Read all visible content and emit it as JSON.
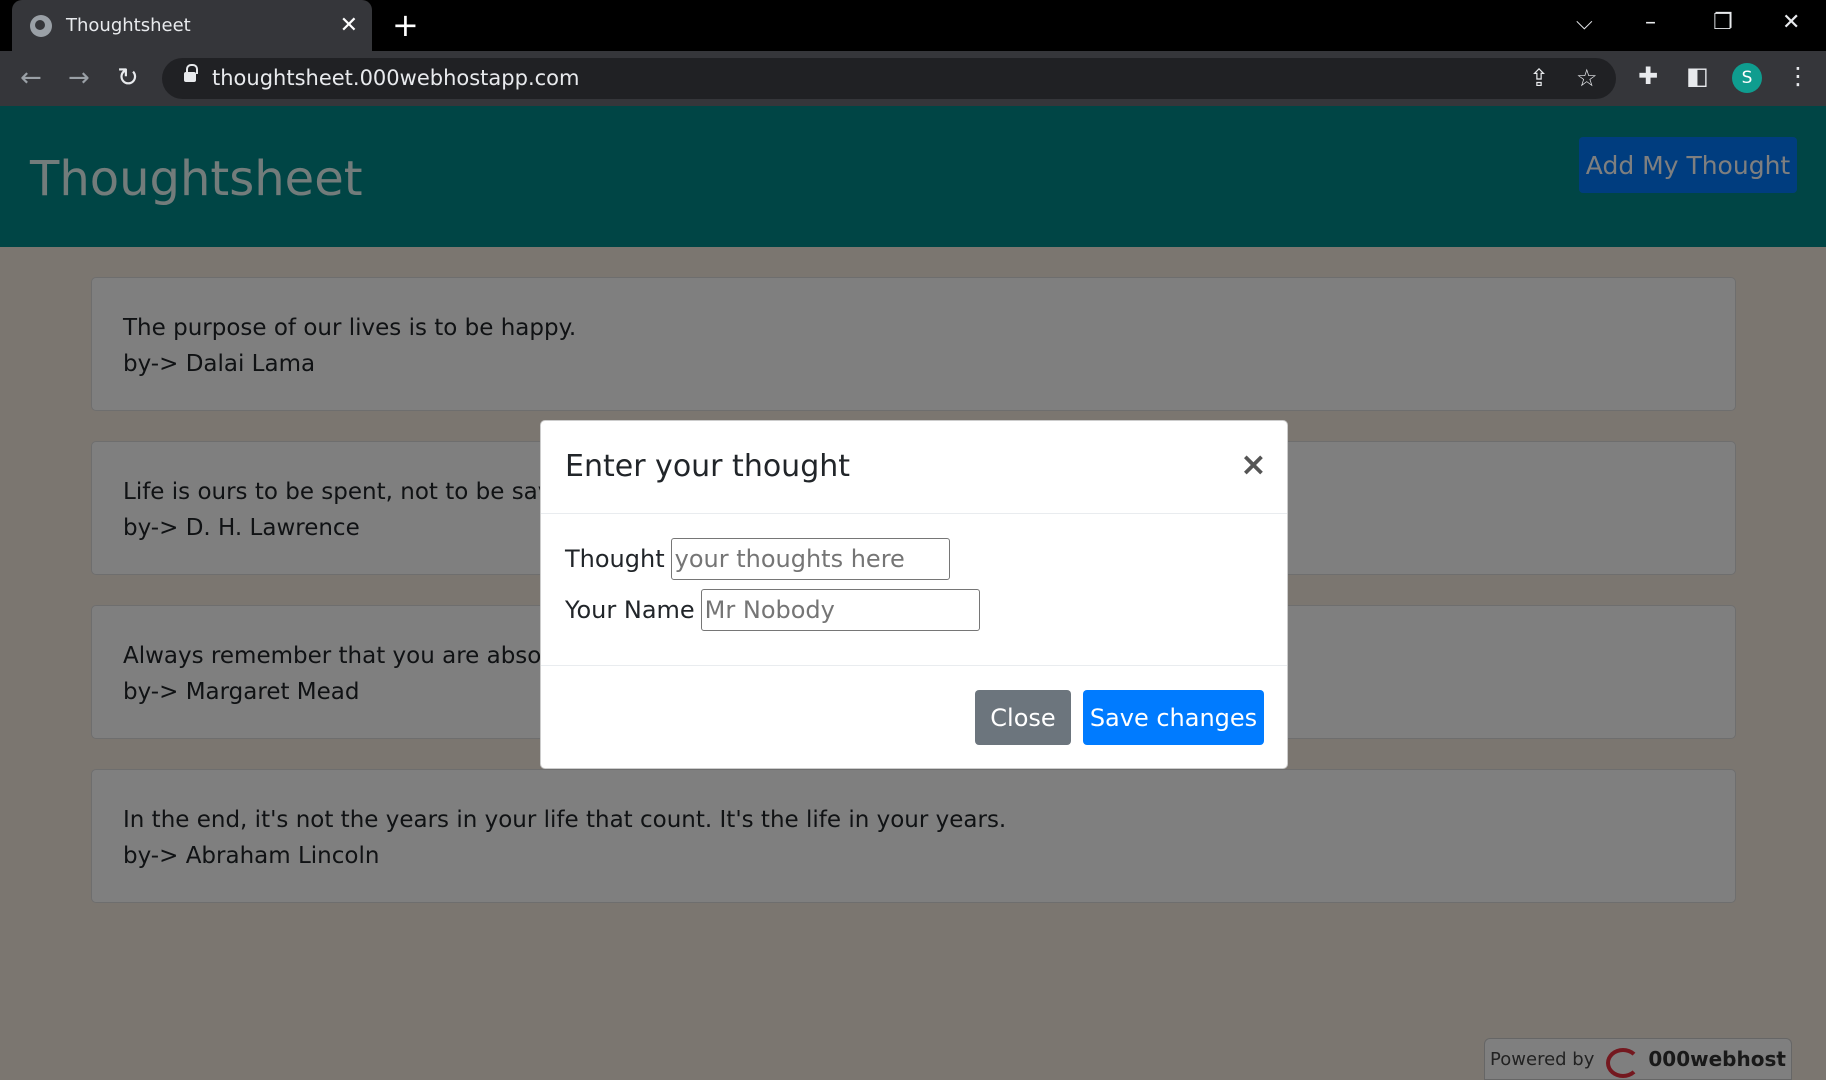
{
  "browser": {
    "tab_title": "Thoughtsheet",
    "tab_close": "✕",
    "new_tab": "+",
    "url": "thoughtsheet.000webhostapp.com",
    "avatar_letter": "S"
  },
  "page": {
    "brand": "Thoughtsheet",
    "add_button": "Add My Thought",
    "thoughts": [
      {
        "text": "The purpose of our lives is to be happy.",
        "author": "by-> Dalai Lama"
      },
      {
        "text": "Life is ours to be spent, not to be saved",
        "author": "by-> D. H. Lawrence"
      },
      {
        "text": "Always remember that you are absolute",
        "author": "by-> Margaret Mead"
      },
      {
        "text": "In the end, it's not the years in your life that count. It's the life in your years.",
        "author": "by-> Abraham Lincoln"
      }
    ],
    "powered_by": "Powered by",
    "host_brand": "000webhost"
  },
  "modal": {
    "title": "Enter your thought",
    "close_symbol": "×",
    "thought_label": "Thought",
    "thought_placeholder": "your thoughts here",
    "name_label": "Your Name",
    "name_placeholder": "Mr Nobody",
    "close_button": "Close",
    "save_button": "Save changes"
  }
}
